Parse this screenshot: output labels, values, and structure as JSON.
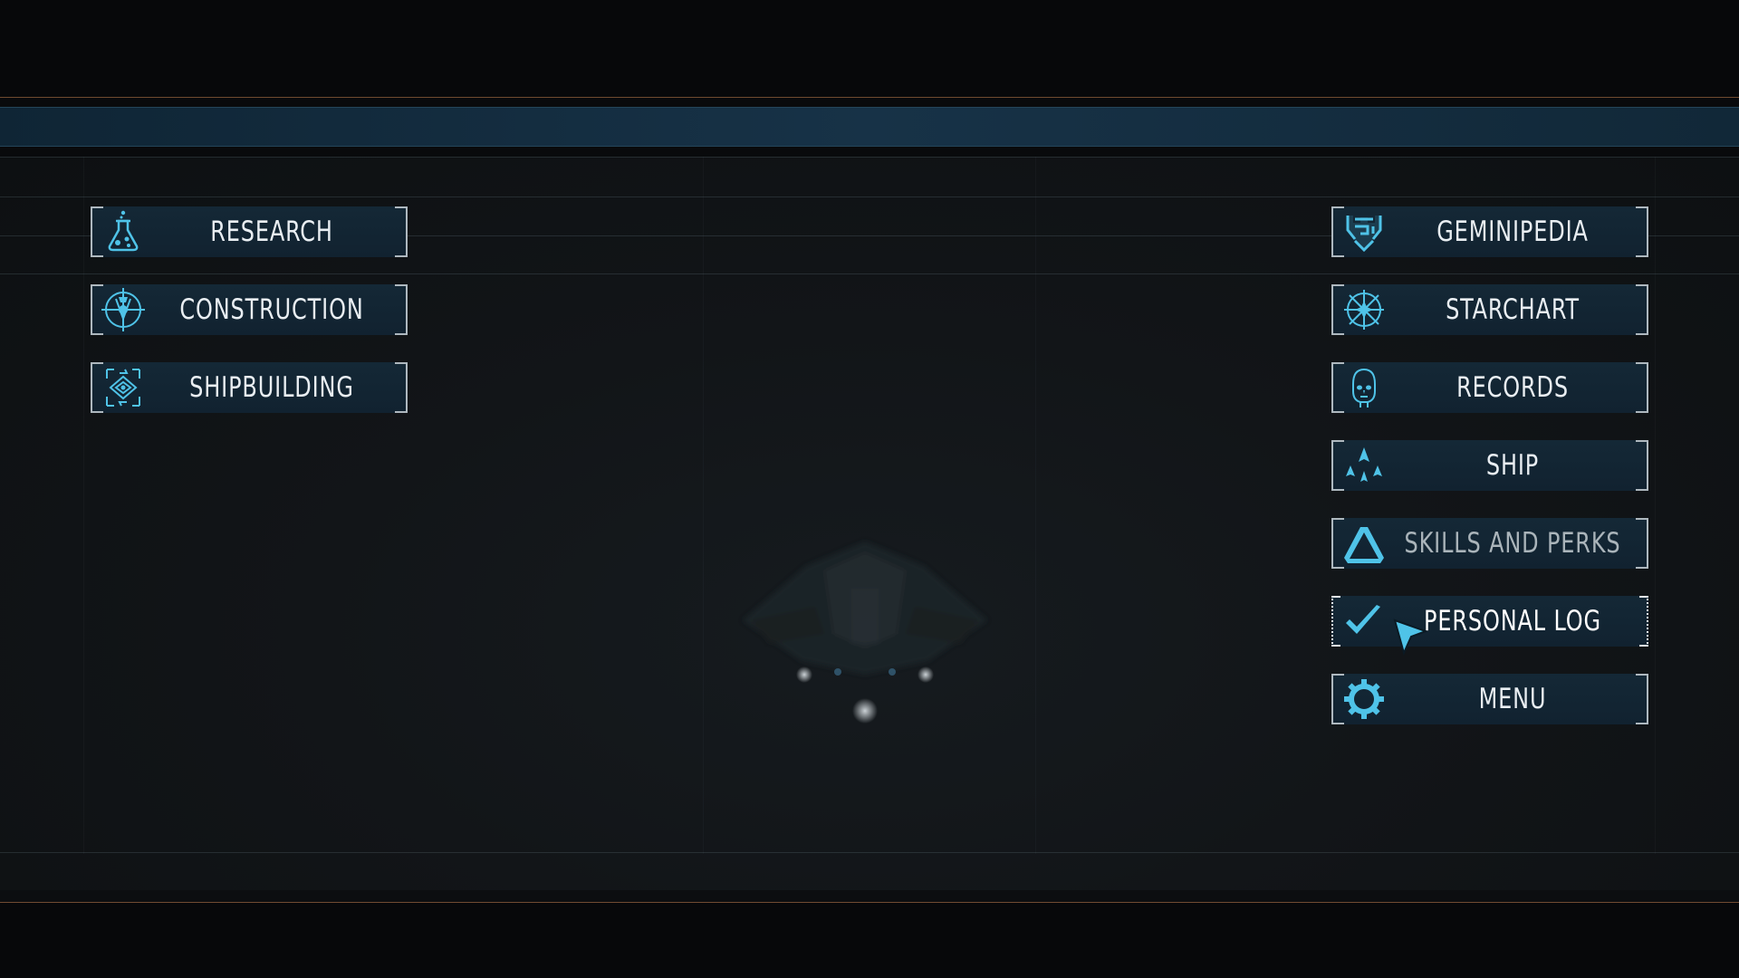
{
  "left_menu": [
    {
      "label": "RESEARCH",
      "icon": "flask-icon"
    },
    {
      "label": "CONSTRUCTION",
      "icon": "crosshair-pin-icon"
    },
    {
      "label": "SHIPBUILDING",
      "icon": "ship-blueprint-icon"
    }
  ],
  "right_menu": [
    {
      "label": "GEMINIPEDIA",
      "icon": "geminipedia-icon"
    },
    {
      "label": "STARCHART",
      "icon": "star-compass-icon"
    },
    {
      "label": "RECORDS",
      "icon": "head-profile-icon"
    },
    {
      "label": "SHIP",
      "icon": "ship-formation-icon"
    },
    {
      "label": "SKILLS AND PERKS",
      "icon": "triangle-icon"
    },
    {
      "label": "PERSONAL LOG",
      "icon": "checkmark-icon"
    },
    {
      "label": "MENU",
      "icon": "gear-icon"
    }
  ],
  "colors": {
    "accent": "#4fc3e8",
    "button_bg": "#132634",
    "header_strip": "#173247",
    "orange_line": "#8a5a3a"
  },
  "state": {
    "hovered_item": "PERSONAL LOG"
  }
}
